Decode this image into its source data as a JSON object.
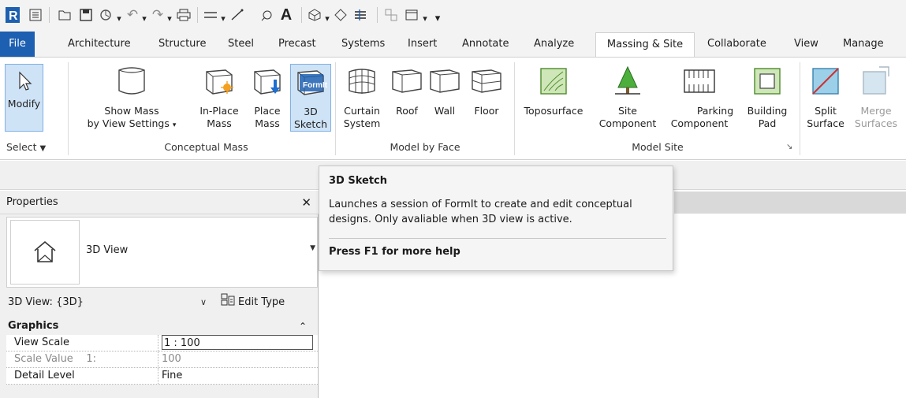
{
  "colors": {
    "accent": "#1d5fb0",
    "selected_bg": "#cfe3f7",
    "tooltip_bg": "#f5f5f5"
  },
  "quick_access": {
    "app_logo": "R",
    "icons": [
      "app-logo-icon",
      "recent-files-icon",
      "open-icon",
      "save-icon",
      "sync-icon",
      "undo-icon",
      "redo-icon",
      "print-icon",
      "measure-icon",
      "dimension-icon",
      "tag-icon",
      "text-icon",
      "3d-view-icon",
      "section-icon",
      "thin-lines-icon",
      "close-hidden-icon",
      "switch-windows-icon",
      "customize-icon"
    ]
  },
  "tabs": [
    "File",
    "Architecture",
    "Structure",
    "Steel",
    "Precast",
    "Systems",
    "Insert",
    "Annotate",
    "Analyze",
    "Massing & Site",
    "Collaborate",
    "View",
    "Manage"
  ],
  "active_tab": "Massing & Site",
  "ribbon": {
    "select": {
      "modify": "Modify",
      "panel": "Select"
    },
    "conceptual_mass": {
      "title": "Conceptual Mass",
      "show_mass_1": "Show Mass",
      "show_mass_2": "by View Settings",
      "in_place_1": "In-Place",
      "in_place_2": "Mass",
      "place_1": "Place",
      "place_2": "Mass",
      "sketch_1": "3D",
      "sketch_2": "Sketch",
      "formit_badge": "FormIt"
    },
    "model_by_face": {
      "title": "Model by Face",
      "curtain_1": "Curtain",
      "curtain_2": "System",
      "roof": "Roof",
      "wall": "Wall",
      "floor": "Floor"
    },
    "model_site": {
      "title": "Model Site",
      "toposurface": "Toposurface",
      "site_1": "Site",
      "site_2": "Component",
      "parking_1": "Parking",
      "parking_2": "Component",
      "pad_1": "Building",
      "pad_2": "Pad"
    },
    "modify_site": {
      "split_1": "Split",
      "split_2": "Surface",
      "merge_1": "Merge",
      "merge_2": "Surfaces"
    }
  },
  "tooltip": {
    "title": "3D Sketch",
    "line1": "Launches a session of FormIt to create and edit conceptual",
    "line2": "designs. Only avaliable when 3D view is active.",
    "help": "Press F1 for more help"
  },
  "properties": {
    "title": "Properties",
    "type_name": "3D View",
    "instance_filter": "3D View: {3D}",
    "edit_type": "Edit Type",
    "group": "Graphics",
    "rows": [
      {
        "label": "View Scale",
        "value": "1 : 100"
      },
      {
        "label": "Scale Value    1:",
        "value": "100"
      },
      {
        "label": "Detail Level",
        "value": "Fine"
      }
    ]
  }
}
